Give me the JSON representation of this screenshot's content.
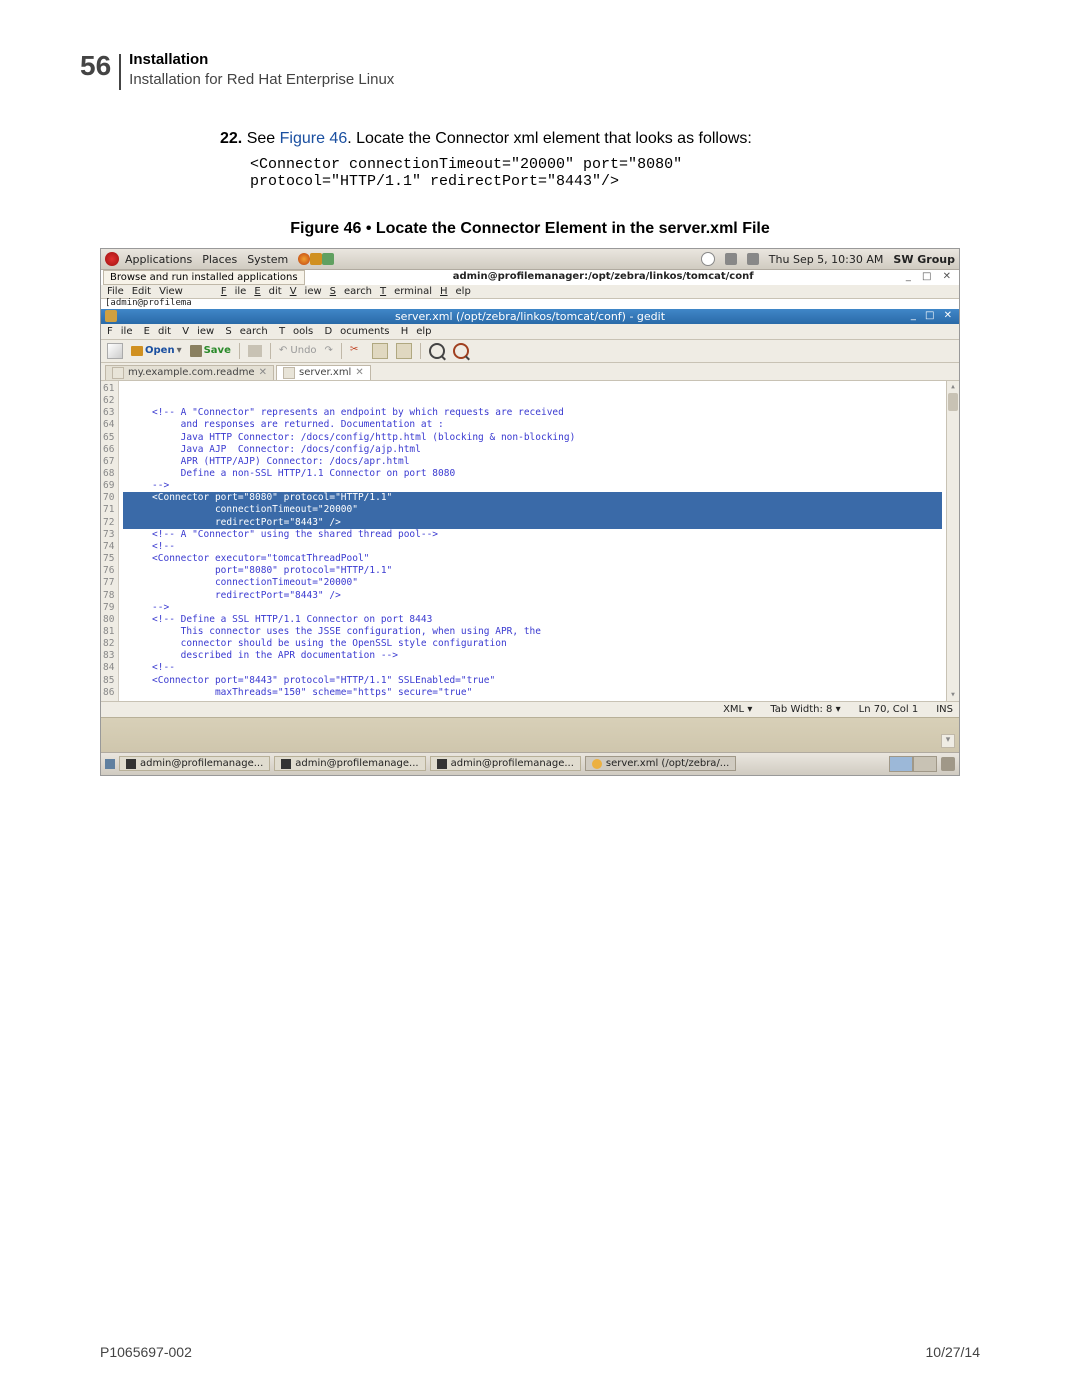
{
  "header": {
    "page_num": "56",
    "title": "Installation",
    "subtitle": "Installation for Red Hat Enterprise Linux"
  },
  "step": {
    "num": "22.",
    "prefix": "See ",
    "link": "Figure 46",
    "suffix": ". Locate the Connector xml element that looks as follows:"
  },
  "code_block": "<Connector connectionTimeout=\"20000\" port=\"8080\"\nprotocol=\"HTTP/1.1\" redirectPort=\"8443\"/>",
  "figure_caption": "Figure 46 • Locate the Connector Element in the server.xml File",
  "gnome": {
    "menus": [
      "Applications",
      "Places",
      "System"
    ],
    "clock": "Thu Sep 5, 10:30 AM",
    "user": "SW Group",
    "tooltip": "Browse and run installed applications"
  },
  "terminal": {
    "title": "admin@profilemanager:/opt/zebra/linkos/tomcat/conf",
    "menus": [
      "File",
      "Edit",
      "View",
      "Search",
      "Terminal",
      "Help"
    ],
    "menus_bg": [
      "File",
      "Edit",
      "View"
    ],
    "prompt": "[admin@profilema"
  },
  "gedit": {
    "title": "server.xml (/opt/zebra/linkos/tomcat/conf) - gedit",
    "menus": [
      "File",
      "Edit",
      "View",
      "Search",
      "Tools",
      "Documents",
      "Help"
    ],
    "toolbar": {
      "open": "Open",
      "save": "Save",
      "undo": "Undo"
    },
    "tabs": {
      "t1": "my.example.com.readme",
      "t2": "server.xml"
    },
    "line_start": 61,
    "line_end": 86,
    "lines": {
      "l61": "",
      "l62": "",
      "l63": "     <!-- A \"Connector\" represents an endpoint by which requests are received",
      "l64": "          and responses are returned. Documentation at :",
      "l65": "          Java HTTP Connector: /docs/config/http.html (blocking & non-blocking)",
      "l66": "          Java AJP  Connector: /docs/config/ajp.html",
      "l67": "          APR (HTTP/AJP) Connector: /docs/apr.html",
      "l68": "          Define a non-SSL HTTP/1.1 Connector on port 8080",
      "l69": "     -->",
      "l70": "     <Connector port=\"8080\" protocol=\"HTTP/1.1\"",
      "l71": "                connectionTimeout=\"20000\"",
      "l72": "                redirectPort=\"8443\" />",
      "l73": "     <!-- A \"Connector\" using the shared thread pool-->",
      "l74": "     <!--",
      "l75": "     <Connector executor=\"tomcatThreadPool\"",
      "l76": "                port=\"8080\" protocol=\"HTTP/1.1\"",
      "l77": "                connectionTimeout=\"20000\"",
      "l78": "                redirectPort=\"8443\" />",
      "l79": "     -->",
      "l80": "     <!-- Define a SSL HTTP/1.1 Connector on port 8443",
      "l81": "          This connector uses the JSSE configuration, when using APR, the",
      "l82": "          connector should be using the OpenSSL style configuration",
      "l83": "          described in the APR documentation -->",
      "l84": "     <!--",
      "l85": "     <Connector port=\"8443\" protocol=\"HTTP/1.1\" SSLEnabled=\"true\"",
      "l86": "                maxThreads=\"150\" scheme=\"https\" secure=\"true\""
    },
    "status": {
      "lang": "XML",
      "tabwidth": "Tab Width: 8",
      "pos": "Ln 70, Col 1",
      "ins": "INS"
    }
  },
  "taskbar": {
    "items": [
      "admin@profilemanage...",
      "admin@profilemanage...",
      "admin@profilemanage...",
      "server.xml (/opt/zebra/..."
    ]
  },
  "footer": {
    "left": "P1065697-002",
    "right": "10/27/14"
  }
}
